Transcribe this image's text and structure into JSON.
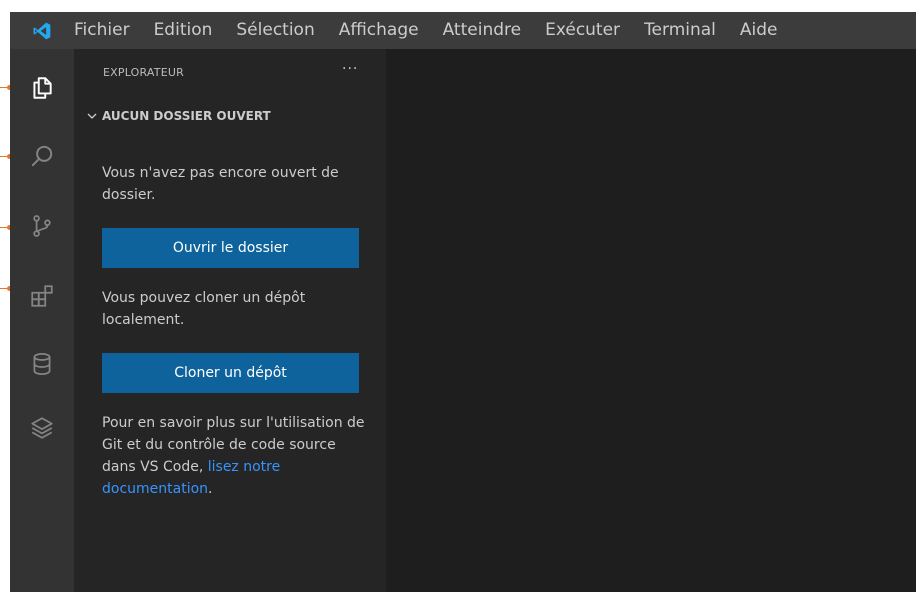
{
  "titlebar": {
    "menu": [
      "Fichier",
      "Edition",
      "Sélection",
      "Affichage",
      "Atteindre",
      "Exécuter",
      "Terminal",
      "Aide"
    ]
  },
  "activitybar": {
    "icons": [
      "explorer-icon",
      "search-icon",
      "source-control-icon",
      "extensions-icon",
      "database-icon",
      "layers-icon"
    ]
  },
  "sidebar": {
    "title": "EXPLORATEUR",
    "more": "···",
    "section_title": "AUCUN DOSSIER OUVERT",
    "no_folder_text": "Vous n'avez pas encore ouvert de dossier.",
    "open_folder_button": "Ouvrir le dossier",
    "clone_text": "Vous pouvez cloner un dépôt localement.",
    "clone_button": "Cloner un dépôt",
    "learn_more_text": "Pour en savoir plus sur l'utilisation de Git et du contrôle de code source dans VS Code,",
    "docs_link": "lisez notre documentation",
    "docs_link_suffix": "."
  },
  "colors": {
    "titlebar_bg": "#3c3c3c",
    "activitybar_bg": "#333333",
    "sidebar_bg": "#252526",
    "editor_bg": "#1e1e1e",
    "button_bg": "#0e639c",
    "link": "#3794ff",
    "logo": "#23a9f2",
    "annotation_marker": "#e8772e"
  }
}
